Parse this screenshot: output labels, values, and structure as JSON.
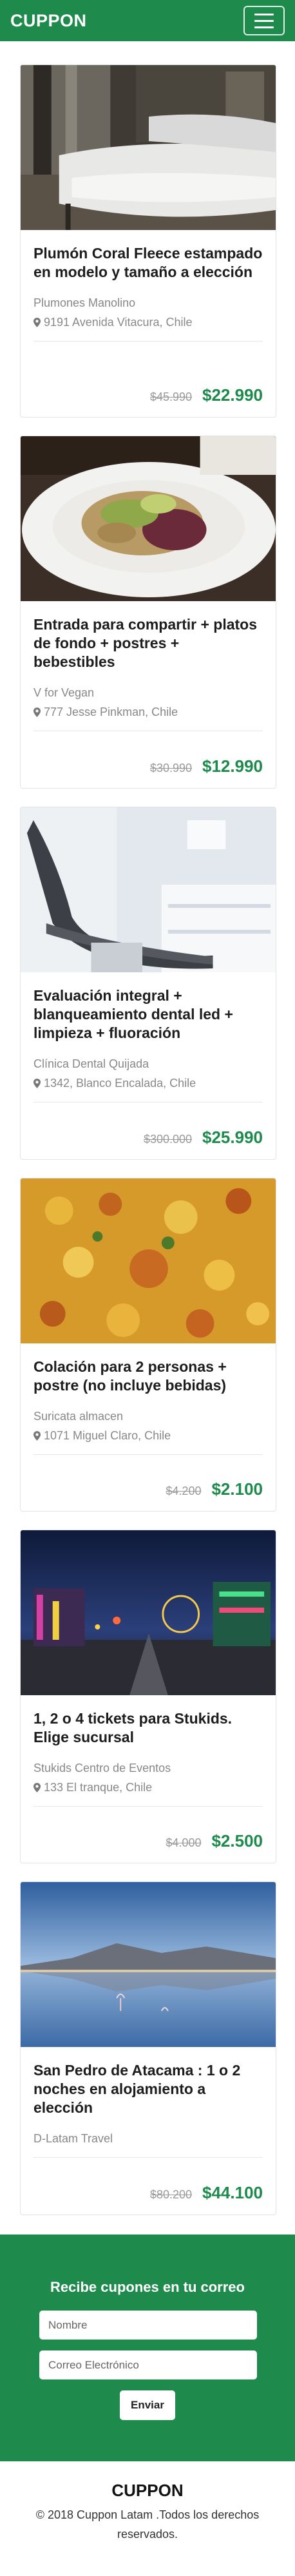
{
  "navbar": {
    "brand": "CUPPON",
    "menu_icon": "hamburger-menu-icon"
  },
  "colors": {
    "brand_green": "#1e8a4c",
    "price_green": "#1e8a4c"
  },
  "deals": [
    {
      "title": "Plumón Coral Fleece estampado en modelo y tamaño a elección",
      "merchant": "Plumones Manolino",
      "address": "9191 Avenida Vitacura, Chile",
      "old_price": "$45.990",
      "new_price": "$22.990"
    },
    {
      "title": "Entrada para compartir + platos de fondo + postres + bebestibles",
      "merchant": "V for Vegan",
      "address": "777 Jesse Pinkman, Chile",
      "old_price": "$30.990",
      "new_price": "$12.990"
    },
    {
      "title": "Evaluación integral + blanqueamiento dental led + limpieza + fluoración",
      "merchant": "Clínica Dental Quijada",
      "address": "1342, Blanco Encalada, Chile",
      "old_price": "$300.000",
      "new_price": "$25.990"
    },
    {
      "title": "Colación para 2 personas + postre (no incluye bebidas)",
      "merchant": "Suricata almacen",
      "address": "1071 Miguel Claro, Chile",
      "old_price": "$4.200",
      "new_price": "$2.100"
    },
    {
      "title": "1, 2 o 4 tickets para Stukids. Elige sucursal",
      "merchant": "Stukids Centro de Eventos",
      "address": "133 El tranque, Chile",
      "old_price": "$4.000",
      "new_price": "$2.500"
    },
    {
      "title": "San Pedro de Atacama : 1 o 2 noches en alojamiento a elección",
      "merchant": "D-Latam Travel",
      "old_price": "$80.200",
      "new_price": "$44.100"
    }
  ],
  "newsletter": {
    "title": "Recibe cupones en tu correo",
    "name_placeholder": "Nombre",
    "email_placeholder": "Correo Electrónico",
    "submit_label": "Enviar"
  },
  "footer": {
    "brand": "CUPPON",
    "copyright": "© 2018 Cuppon Latam .Todos los derechos reservados."
  }
}
